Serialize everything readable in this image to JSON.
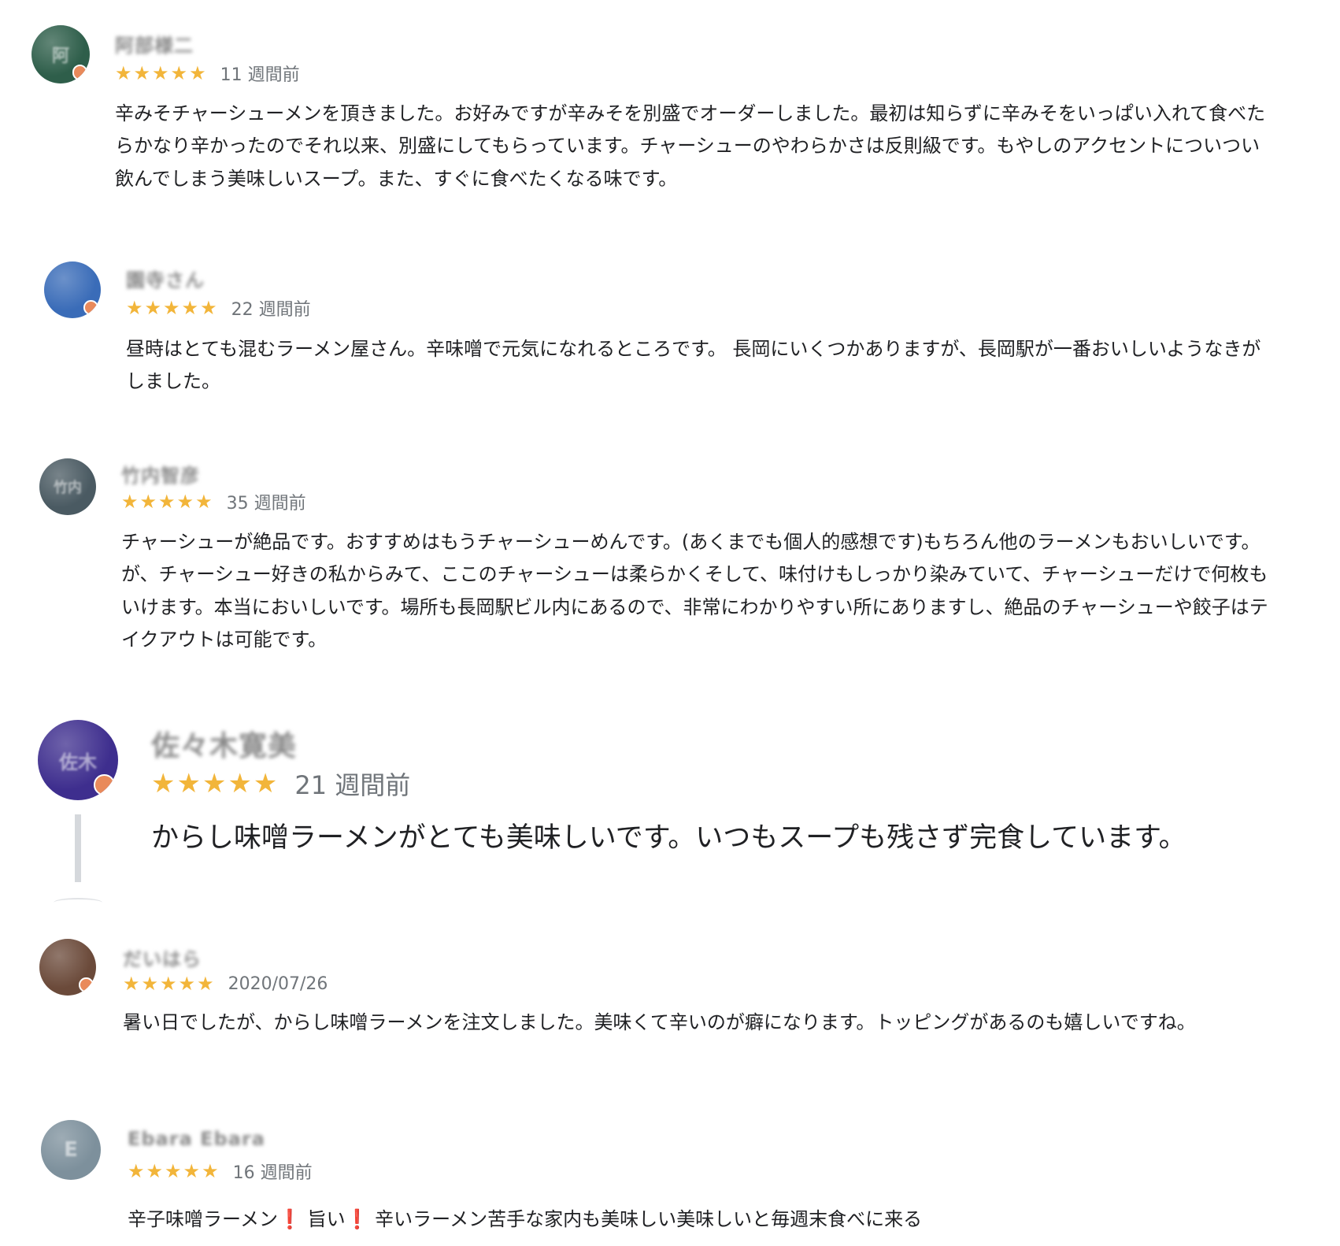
{
  "reviews": [
    {
      "name": "阿部様二",
      "avatar_initial": "阿",
      "avatar_color": "#2e5e4a",
      "stars": "★★★★★",
      "rating": 5,
      "date": "11 週間前",
      "text": "辛みそチャーシューメンを頂きました。お好みですが辛みそを別盛でオーダーしました。最初は知らずに辛みそをいっぱい入れて食べたらかなり辛かったのでそれ以来、別盛にしてもらっています。チャーシューのやわらかさは反則級です。もやしのアクセントについつい飲んでしまう美味しいスープ。また、すぐに食べたくなる味です。"
    },
    {
      "name": "園寺さん",
      "avatar_initial": "",
      "avatar_color": "#3a6cb8",
      "stars": "★★★★★",
      "rating": 5,
      "date": "22 週間前",
      "text": "昼時はとても混むラーメン屋さん。辛味噌で元気になれるところです。 長岡にいくつかありますが、長岡駅が一番おいしいようなきがしました。"
    },
    {
      "name": "竹内智彦",
      "avatar_initial": "竹内",
      "avatar_color": "#4a5a62",
      "stars": "★★★★★",
      "rating": 5,
      "date": "35 週間前",
      "text": "チャーシューが絶品です。おすすめはもうチャーシューめんです。(あくまでも個人的感想です)もちろん他のラーメンもおいしいです。が、チャーシュー好きの私からみて、ここのチャーシューは柔らかくそして、味付けもしっかり染みていて、チャーシューだけで何枚もいけます。本当においしいです。場所も長岡駅ビル内にあるので、非常にわかりやすい所にありますし、絶品のチャーシューや餃子はテイクアウトは可能です。"
    },
    {
      "name": "佐々木寛美",
      "avatar_initial": "佐木",
      "avatar_color": "#3e2e8e",
      "stars": "★★★★★",
      "rating": 5,
      "date": "21 週間前",
      "text": "からし味噌ラーメンがとても美味しいです。いつもスープも残さず完食しています。"
    },
    {
      "name": "だいはら",
      "avatar_initial": "",
      "avatar_color": "#6b4a3a",
      "stars": "★★★★★",
      "rating": 5,
      "date": "2020/07/26",
      "text": "暑い日でしたが、からし味噌ラーメンを注文しました。美味くて辛いのが癖になります。トッピングがあるのも嬉しいですね。"
    },
    {
      "name": "Ebara Ebara",
      "avatar_initial": "E",
      "avatar_color": "#7d909c",
      "stars": "★★★★★",
      "rating": 5,
      "date": "16 週間前",
      "text_parts": [
        "辛子味噌ラーメン",
        "❗",
        " 旨い",
        "❗",
        " 辛いラーメン苦手な家内も美味しい美味しいと毎週末食べに来る"
      ]
    }
  ]
}
